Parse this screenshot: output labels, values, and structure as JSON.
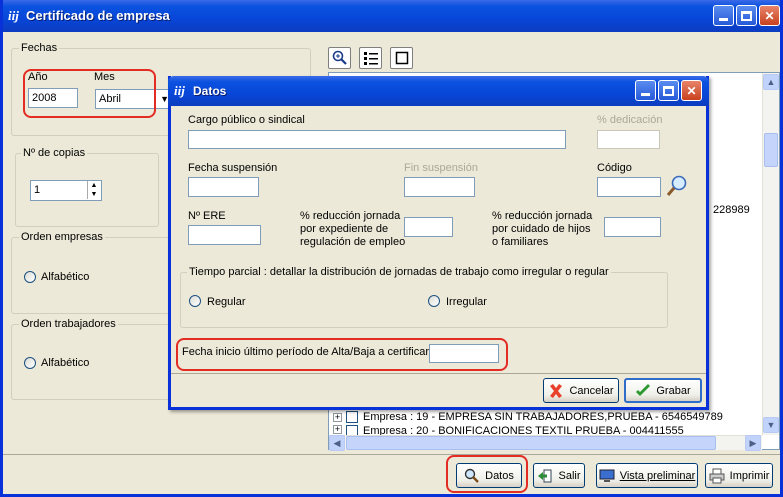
{
  "window": {
    "logo": "iij",
    "title": "Certificado de empresa"
  },
  "left": {
    "fechas": {
      "legend": "Fechas",
      "year_label": "Año",
      "year_value": "2008",
      "month_label": "Mes",
      "month_value": "Abril"
    },
    "copias": {
      "legend": "Nº de copias",
      "value": "1"
    },
    "orden_empresas": {
      "legend": "Orden empresas",
      "option": "Alfabético"
    },
    "orden_trabajadores": {
      "legend": "Orden trabajadores",
      "option": "Alfabético"
    }
  },
  "tree": {
    "partial_text": "228989",
    "rows": [
      "Empresa : 19 - EMPRESA SIN TRABAJADORES,PRUEBA - 6546549789",
      "Empresa : 20 - BONIFICACIONES TEXTIL PRUEBA - 004411555"
    ]
  },
  "buttons": {
    "datos": "Datos",
    "salir": "Salir",
    "vista": "Vista preliminar",
    "imprimir": "Imprimir"
  },
  "dialog": {
    "logo": "iij",
    "title": "Datos",
    "cargo_label": "Cargo público o sindical",
    "dedicacion_label": "% dedicación",
    "fecha_susp_label": "Fecha suspensión",
    "fin_susp_label": "Fin suspensión",
    "codigo_label": "Código",
    "ere_label": "Nº ERE",
    "red_expediente_label": [
      "% reducción jornada",
      "por expediente de",
      "regulación de empleo"
    ],
    "red_cuidado_label": [
      "% reducción jornada",
      "por cuidado de hijos",
      "o familiares"
    ],
    "tiempo_parcial_legend": "Tiempo parcial : detallar la distribución de jornadas de trabajo como irregular o regular",
    "regular": "Regular",
    "irregular": "Irregular",
    "fecha_inicio_label": "Fecha inicio último período de Alta/Baja a certificar",
    "cancelar": "Cancelar",
    "grabar": "Grabar"
  }
}
